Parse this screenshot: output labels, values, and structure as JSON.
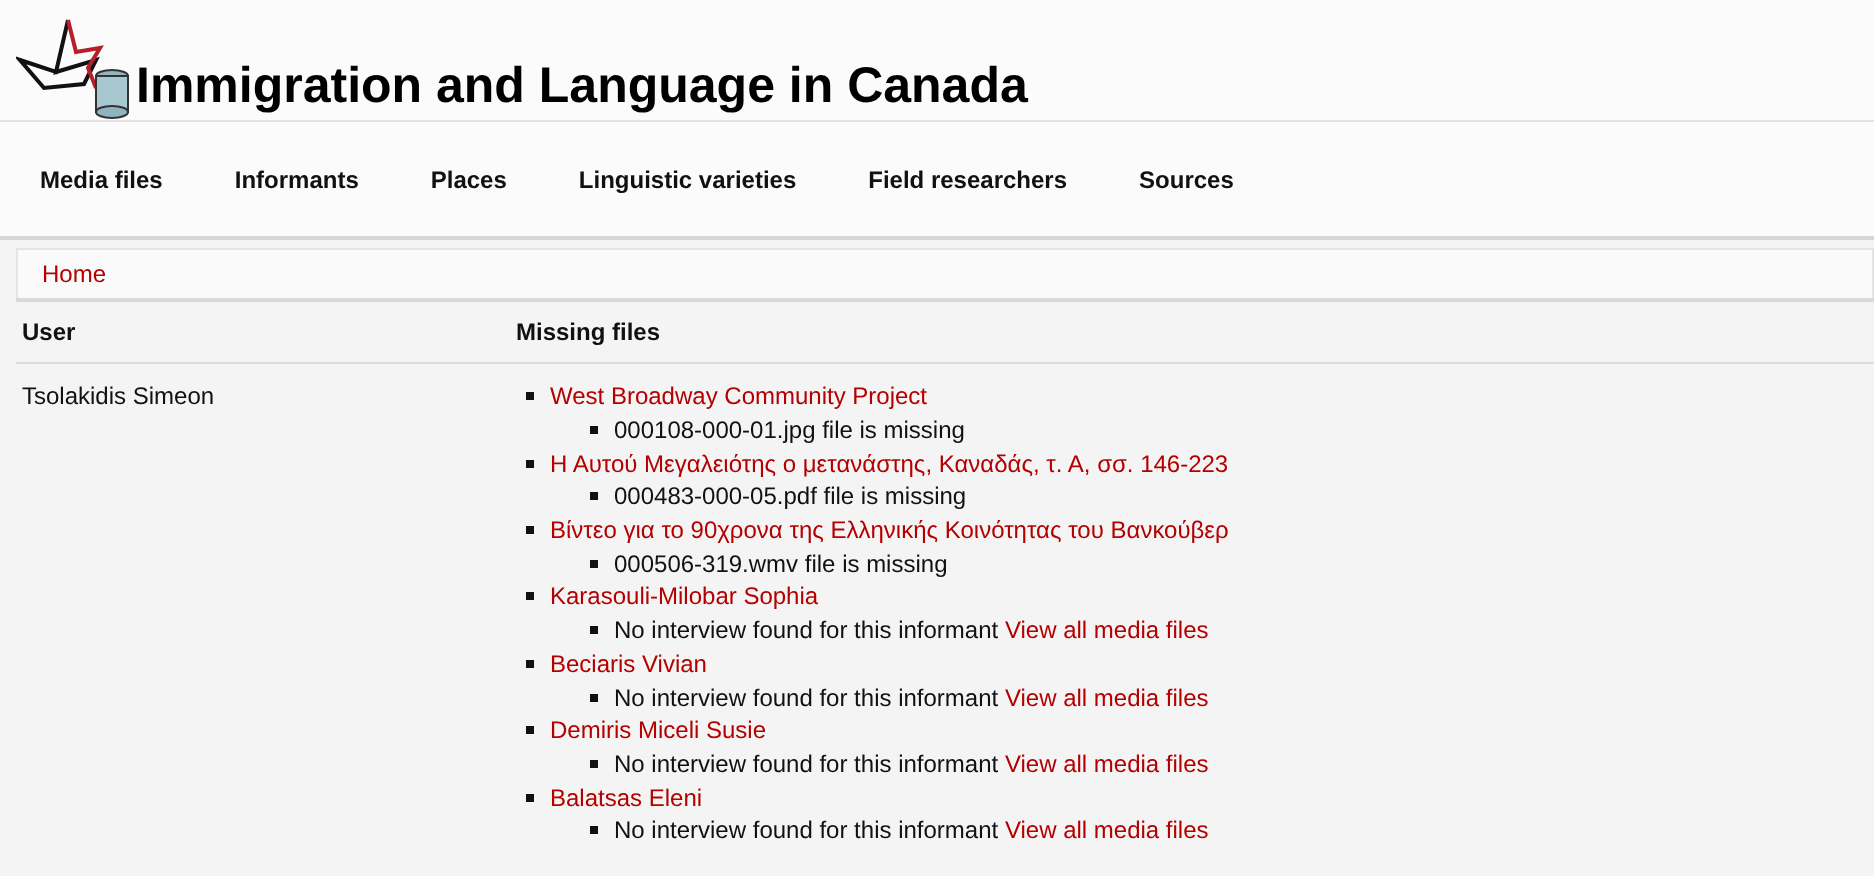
{
  "site_title": "Immigration and Language in Canada",
  "nav": [
    "Media files",
    "Informants",
    "Places",
    "Linguistic varieties",
    "Field researchers",
    "Sources"
  ],
  "breadcrumb": [
    "Home"
  ],
  "table": {
    "columns": [
      "User",
      "Missing files"
    ],
    "rows": [
      {
        "user": "Tsolakidis Simeon",
        "items": [
          {
            "title": "West Broadway Community Project",
            "note": "000108-000-01.jpg file is missing"
          },
          {
            "title": "Η Αυτού Μεγαλειότης ο μετανάστης, Καναδάς, τ. Α, σσ. 146-223",
            "note": "000483-000-05.pdf file is missing"
          },
          {
            "title": "Βίντεο για το 90χρονα της Ελληνικής Κοινότητας του Βανκούβερ",
            "note": "000506-319.wmv file is missing"
          },
          {
            "title": "Karasouli-Milobar Sophia",
            "note": "No interview found for this informant",
            "link": "View all media files"
          },
          {
            "title": "Beciaris Vivian",
            "note": "No interview found for this informant",
            "link": "View all media files"
          },
          {
            "title": "Demiris Miceli Susie",
            "note": "No interview found for this informant",
            "link": "View all media files"
          },
          {
            "title": "Balatsas Eleni",
            "note": "No interview found for this informant",
            "link": "View all media files"
          }
        ]
      }
    ]
  }
}
